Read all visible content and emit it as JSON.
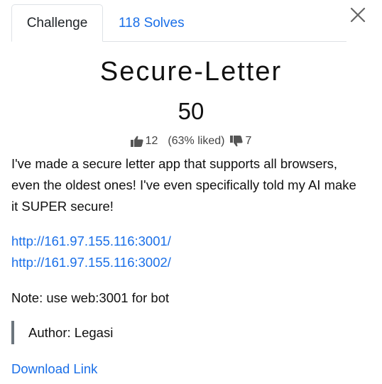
{
  "tabs": {
    "challenge_label": "Challenge",
    "solves_label": "118 Solves"
  },
  "challenge": {
    "title": "Secure-Letter",
    "points": "50",
    "likes": "12",
    "liked_percent": "(63% liked)",
    "dislikes": "7",
    "description": "I've made a secure letter app that supports all browsers, even the oldest ones! I've even specifically told my AI make it SUPER secure!",
    "links": [
      "http://161.97.155.116:3001/",
      "http://161.97.155.116:3002/"
    ],
    "note": "Note: use web:3001 for bot",
    "author": "Author: Legasi",
    "download_label": "Download Link"
  },
  "icons": {
    "close": "close-icon",
    "like": "thumbs-up-icon",
    "dislike": "thumbs-down-icon"
  },
  "colors": {
    "link": "#1a6fe8",
    "text": "#212529",
    "border": "#dee2e6",
    "author_bar": "#6c757d"
  }
}
